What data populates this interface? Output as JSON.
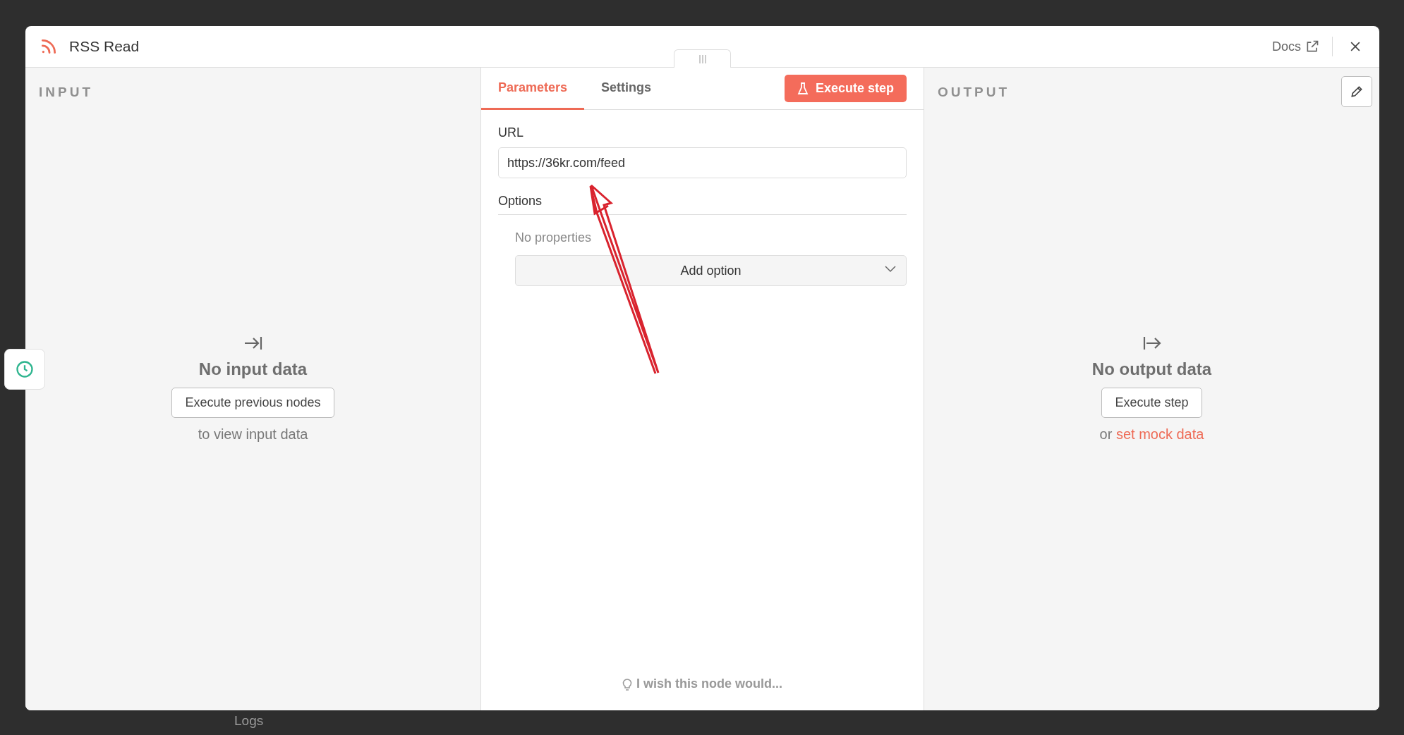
{
  "background": {
    "footer_label": "Logs"
  },
  "window": {
    "title": "RSS Read",
    "docs_link": "Docs"
  },
  "input_panel": {
    "heading": "INPUT",
    "empty_title": "No input data",
    "button": "Execute previous nodes",
    "hint": "to view input data"
  },
  "tabs": [
    {
      "label": "Parameters",
      "selected": true
    },
    {
      "label": "Settings",
      "selected": false
    }
  ],
  "execute_button": "Execute step",
  "parameters": {
    "url_label": "URL",
    "url_value": "https://36kr.com/feed",
    "options_label": "Options",
    "empty_options": "No properties",
    "add_option": "Add option"
  },
  "feedback": "I wish this node would...",
  "output_panel": {
    "heading": "OUTPUT",
    "empty_title": "No output data",
    "button": "Execute step",
    "hint_prefix": "or",
    "hint_link": "set mock data"
  }
}
